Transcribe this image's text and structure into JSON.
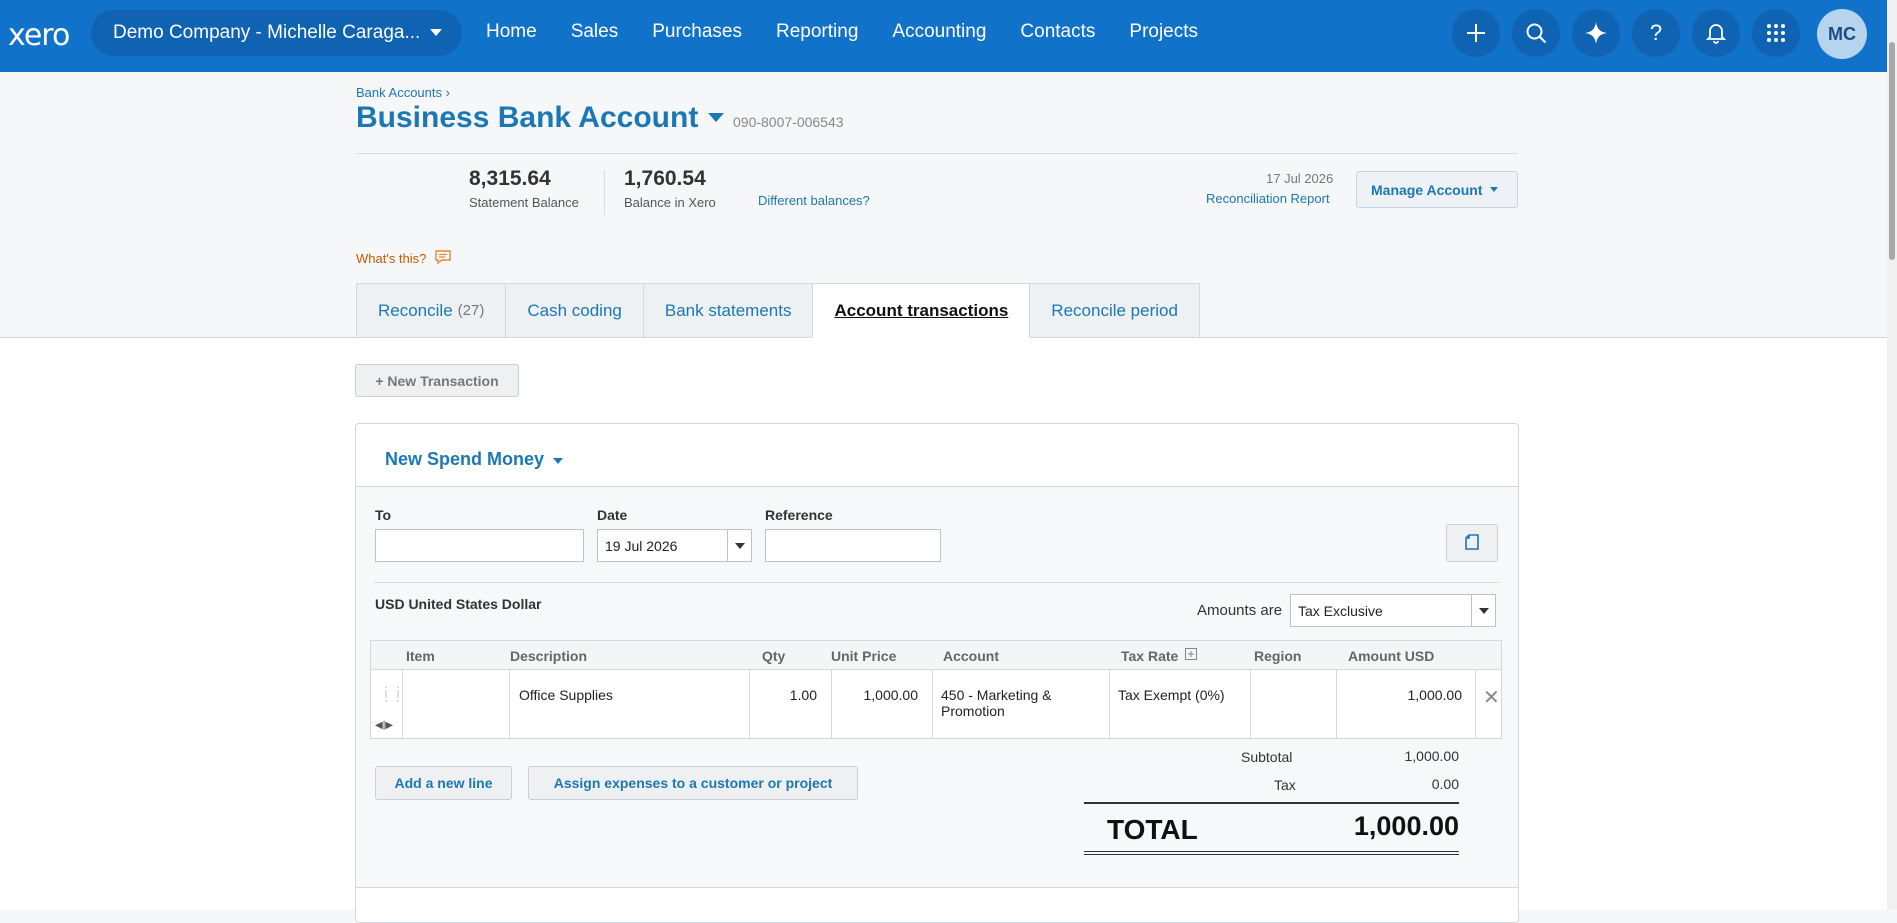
{
  "nav": {
    "logo": "xero",
    "org_name": "Demo Company - Michelle Caraga...",
    "links": [
      "Home",
      "Sales",
      "Purchases",
      "Reporting",
      "Accounting",
      "Contacts",
      "Projects"
    ],
    "icons": [
      "plus-icon",
      "search-icon",
      "sparkle-icon",
      "help-icon",
      "bell-icon",
      "apps-grid-icon"
    ],
    "avatar_initials": "MC",
    "bar_color": "#1172c9"
  },
  "header": {
    "breadcrumb": "Bank Accounts ›",
    "account_name": "Business Bank Account",
    "account_number": "090-8007-006543",
    "statement_balance": "8,315.64",
    "statement_balance_label": "Statement Balance",
    "xero_balance": "1,760.54",
    "xero_balance_label": "Balance in Xero",
    "different_balances": "Different balances?",
    "reconciliation_date": "17 Jul 2026",
    "reconciliation_report": "Reconciliation Report",
    "manage_account": "Manage Account",
    "whats_this": "What's this?"
  },
  "tabs": [
    {
      "label": "Reconcile",
      "count": "(27)"
    },
    {
      "label": "Cash coding",
      "count": ""
    },
    {
      "label": "Bank statements",
      "count": ""
    },
    {
      "label": "Account transactions",
      "count": "",
      "active": true
    },
    {
      "label": "Reconcile period",
      "count": ""
    }
  ],
  "new_transaction": "+ New Transaction",
  "form": {
    "title": "New Spend Money",
    "to_label": "To",
    "to_value": "",
    "date_label": "Date",
    "date_value": "19 Jul 2026",
    "reference_label": "Reference",
    "reference_value": "",
    "currency": "USD United States Dollar",
    "amounts_are_label": "Amounts are",
    "amounts_are_value": "Tax Exclusive"
  },
  "lines": {
    "headers": [
      "Item",
      "Description",
      "Qty",
      "Unit Price",
      "Account",
      "Tax Rate",
      "Region",
      "Amount USD"
    ],
    "rows": [
      {
        "item": "",
        "description": "Office Supplies",
        "qty": "1.00",
        "unit_price": "1,000.00",
        "account": "450 - Marketing & Promotion",
        "tax_rate": "Tax Exempt (0%)",
        "region": "",
        "amount": "1,000.00"
      }
    ]
  },
  "buttons": {
    "add_line": "Add a new line",
    "assign_expenses": "Assign expenses to a customer or project"
  },
  "totals": {
    "subtotal_label": "Subtotal",
    "subtotal": "1,000.00",
    "tax_label": "Tax",
    "tax": "0.00",
    "total_label": "TOTAL",
    "total": "1,000.00"
  }
}
